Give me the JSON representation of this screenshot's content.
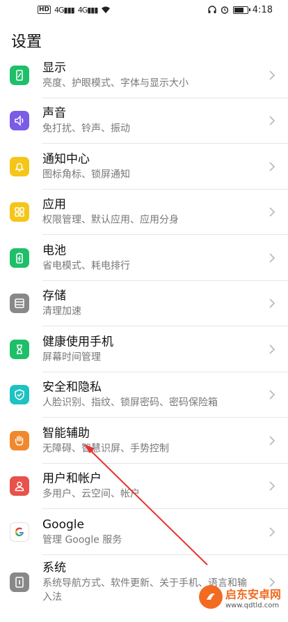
{
  "status_bar": {
    "hd": "HD",
    "signal_1": "4G",
    "signal_2": "4G",
    "time": "4:18",
    "battery_level": 0.8
  },
  "header": {
    "title": "设置"
  },
  "items": [
    {
      "label": "显示",
      "sub": "亮度、护眼模式、字体与显示大小",
      "icon": "display-icon",
      "color": "#1fbf6a"
    },
    {
      "label": "声音",
      "sub": "免打扰、铃声、振动",
      "icon": "speaker-icon",
      "color": "#7a5ce6"
    },
    {
      "label": "通知中心",
      "sub": "图标角标、锁屏通知",
      "icon": "bell-icon",
      "color": "#f5c518"
    },
    {
      "label": "应用",
      "sub": "权限管理、默认应用、应用分身",
      "icon": "apps-icon",
      "color": "#f5c518"
    },
    {
      "label": "电池",
      "sub": "省电模式、耗电排行",
      "icon": "battery-icon",
      "color": "#1fbf6a"
    },
    {
      "label": "存储",
      "sub": "清理加速",
      "icon": "storage-icon",
      "color": "#888888"
    },
    {
      "label": "健康使用手机",
      "sub": "屏幕时间管理",
      "icon": "hourglass-icon",
      "color": "#1fbf6a"
    },
    {
      "label": "安全和隐私",
      "sub": "人脸识别、指纹、锁屏密码、密码保险箱",
      "icon": "shield-icon",
      "color": "#1ec2c2"
    },
    {
      "label": "智能辅助",
      "sub": "无障碍、智慧识屏、手势控制",
      "icon": "hand-icon",
      "color": "#f0892e"
    },
    {
      "label": "用户和帐户",
      "sub": "多用户、云空间、帐户",
      "icon": "user-icon",
      "color": "#e8524c"
    },
    {
      "label": "Google",
      "sub": "管理 Google 服务",
      "icon": "google-icon",
      "color": "#ffffff"
    },
    {
      "label": "系统",
      "sub": "系统导航方式、软件更新、关于手机、语言和输入法",
      "icon": "system-icon",
      "color": "#888888"
    }
  ],
  "watermark": {
    "name": "启东安卓网",
    "url": "www.qdtld.com"
  }
}
